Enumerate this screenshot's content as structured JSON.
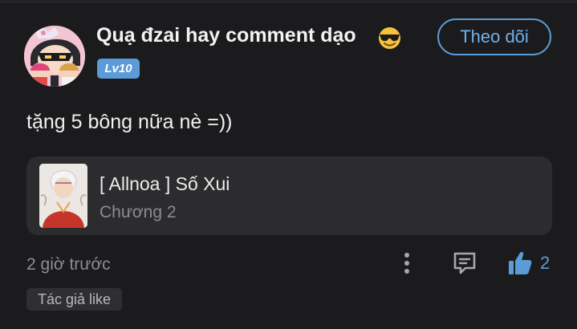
{
  "comment": {
    "username": "Quạ đzai hay comment dạo",
    "username_emoji": "sunglasses-emoji",
    "level_badge": "Lv10",
    "follow_label": "Theo dõi",
    "text": "tặng 5 bông nữa nè =))",
    "timestamp": "2 giờ trước",
    "like_count": "2",
    "author_tag": "Tác giả like"
  },
  "story": {
    "title": "[ Allnoa ] Số Xui",
    "chapter": "Chương 2"
  },
  "icons": {
    "more": "more-vertical-icon",
    "reply": "reply-comment-icon",
    "like": "thumbs-up-icon"
  },
  "colors": {
    "background": "#1b1b1d",
    "accent": "#5a9bd8",
    "card": "#2c2c2e",
    "muted_text": "#8e8e92"
  }
}
